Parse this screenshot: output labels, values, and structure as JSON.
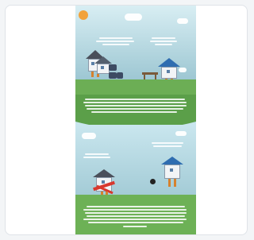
{
  "thumbnail": {
    "alt": "infographic",
    "logo": {
      "line1": "",
      "line2": ""
    }
  },
  "colors": {
    "sky": "#c4e4ee",
    "grass": "#6cae55",
    "house_wall": "#f2f4f6",
    "roof_blue": "#2f6db0",
    "roof_dark": "#4a4f5a",
    "accent_orange": "#d6812e",
    "scarf_red": "#d8382e"
  },
  "icons": [
    "logo-mark-icon",
    "cloud-icon",
    "house-icon",
    "barrel-icon"
  ]
}
